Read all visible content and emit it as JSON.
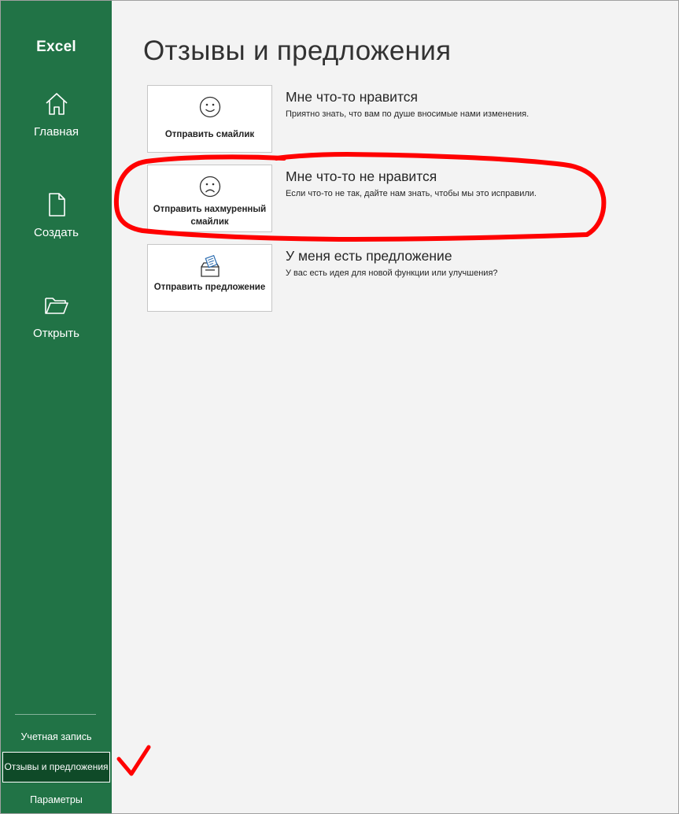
{
  "app": {
    "name": "Excel"
  },
  "sidebar": {
    "nav": [
      {
        "label": "Главная",
        "icon": "home-icon"
      },
      {
        "label": "Создать",
        "icon": "new-document-icon"
      },
      {
        "label": "Открыть",
        "icon": "open-folder-icon"
      }
    ],
    "bottom": [
      {
        "label": "Учетная запись"
      },
      {
        "label": "Отзывы и предложения",
        "selected": true
      },
      {
        "label": "Параметры"
      }
    ]
  },
  "main": {
    "title": "Отзывы и предложения",
    "options": [
      {
        "button_label": "Отправить смайлик",
        "icon": "smile-icon",
        "title": "Мне что-то нравится",
        "description": "Приятно знать, что вам по душе вносимые нами изменения."
      },
      {
        "button_label": "Отправить нахмуренный смайлик",
        "icon": "frown-icon",
        "title": "Мне что-то не нравится",
        "description": "Если что-то не так, дайте нам знать, чтобы мы это исправили."
      },
      {
        "button_label": "Отправить предложение",
        "icon": "suggestion-box-icon",
        "title": "У меня есть предложение",
        "description": "У вас есть идея для новой функции или улучшения?"
      }
    ]
  },
  "colors": {
    "sidebar_bg": "#217346",
    "selected_bg": "#0f4a28",
    "annotation": "#ff0000"
  }
}
